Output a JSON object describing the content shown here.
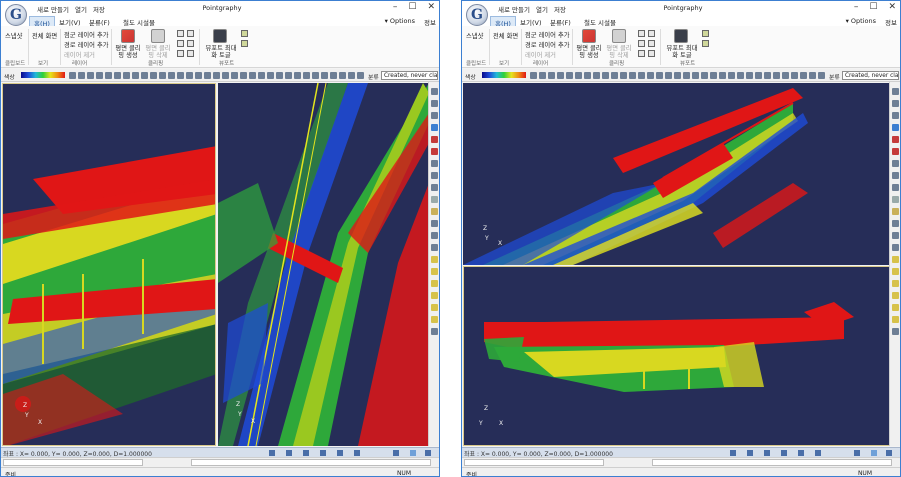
{
  "windows": [
    {
      "id": "left",
      "qat": [
        "새로 만들기",
        "열기",
        "저장"
      ],
      "app_title": "Pointgraphy",
      "tabs": [
        {
          "label": "홈(H)",
          "active": true
        },
        {
          "label": "보기(V)",
          "active": false
        },
        {
          "label": "분류(F)",
          "active": false
        },
        {
          "label": "철도 시설물",
          "active": false
        }
      ],
      "options_label": "Options",
      "info_label": "정보",
      "ribbon": {
        "btn_scan": "스냅샷",
        "btn_fullscreen": "전체 화면",
        "btn_add_point_layer": "점군 레이어 추가",
        "btn_add_path_layer": "경로 레이어 추가",
        "btn_remove_layer": "레이어 제거",
        "btn_plane_clip_create": "평면 클리핑 생성",
        "btn_plane_clip_delete": "평면 클리핑 삭제",
        "btn_viewport_max": "뷰포트 최대화 토글",
        "group_clipboard": "클립보드",
        "group_view": "보기",
        "group_layer": "레이어",
        "group_clipping": "클리핑",
        "group_viewport": "뷰포트"
      },
      "toolbar": {
        "color_label": "색상",
        "classify_label": "분류",
        "classify_value": "Created, never clas"
      },
      "viewports": [
        {
          "axis_z": "Z",
          "axis_y": "Y",
          "axis_x": "X"
        },
        {
          "axis_z": "Z",
          "axis_y": "Y",
          "axis_x": "X"
        }
      ],
      "status": {
        "coords": "좌표 : X= 0.000, Y= 0.000, Z=0.000, D=1.000000"
      },
      "bottom": {
        "ready": "준비",
        "num": "NUM"
      }
    },
    {
      "id": "right",
      "qat": [
        "새로 만들기",
        "열기",
        "저장"
      ],
      "app_title": "Pointgraphy",
      "tabs": [
        {
          "label": "홈(H)",
          "active": true
        },
        {
          "label": "보기(V)",
          "active": false
        },
        {
          "label": "분류(F)",
          "active": false
        },
        {
          "label": "철도 시설물",
          "active": false
        }
      ],
      "options_label": "Options",
      "info_label": "정보",
      "ribbon": {
        "btn_scan": "스냅샷",
        "btn_fullscreen": "전체 화면",
        "btn_add_point_layer": "점군 레이어 추가",
        "btn_add_path_layer": "경로 레이어 추가",
        "btn_remove_layer": "레이어 제거",
        "btn_plane_clip_create": "평면 클리핑 생성",
        "btn_plane_clip_delete": "평면 클리핑 삭제",
        "btn_viewport_max": "뷰포트 최대화 토글",
        "group_clipboard": "클립보드",
        "group_view": "보기",
        "group_layer": "레이어",
        "group_clipping": "클리핑",
        "group_viewport": "뷰포트"
      },
      "toolbar": {
        "color_label": "색상",
        "classify_label": "분류",
        "classify_value": "Created, never clas"
      },
      "viewports": [
        {
          "axis_z": "Z",
          "axis_y": "Y",
          "axis_x": "X"
        },
        {
          "axis_z": "Z",
          "axis_y": "Y",
          "axis_x": "X"
        }
      ],
      "status": {
        "coords": "좌표 : X= 0.000, Y= 0.000, Z=0.000, D=1.000000"
      },
      "bottom": {
        "ready": "준비",
        "num": "NUM"
      }
    }
  ],
  "colors": {
    "canvas_bg": "#262d58",
    "accent": "#3c7fd1",
    "ramp_red": "#e01616",
    "ramp_yellow": "#e4e41e",
    "ramp_green": "#2ed03a",
    "ramp_blue": "#1e4bd8"
  }
}
